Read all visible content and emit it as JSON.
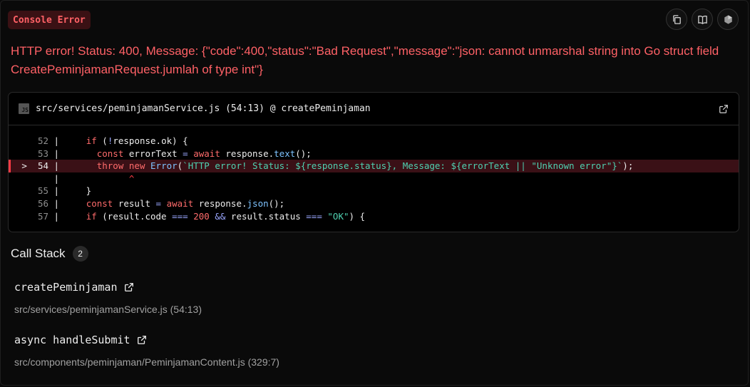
{
  "badge": "Console Error",
  "message": "HTTP error! Status: 400, Message: {\"code\":400,\"status\":\"Bad Request\",\"message\":\"json: cannot unmarshal string into Go struct field CreatePeminjamanRequest.jumlah of type int\"}",
  "code_frame": {
    "file_icon_label": "JS",
    "location": "src/services/peminjamanService.js (54:13) @ createPeminjaman",
    "lines": [
      {
        "num": "52",
        "prefix": " "
      },
      {
        "num": "53",
        "prefix": " "
      },
      {
        "num": "54",
        "prefix": ">"
      },
      {
        "num": "",
        "prefix": " "
      },
      {
        "num": "55",
        "prefix": " "
      },
      {
        "num": "56",
        "prefix": " "
      },
      {
        "num": "57",
        "prefix": " "
      }
    ]
  },
  "call_stack": {
    "title": "Call Stack",
    "count": "2",
    "frames": [
      {
        "fn": "createPeminjaman",
        "loc": "src/services/peminjamanService.js (54:13)"
      },
      {
        "fn": "async handleSubmit",
        "loc": "src/components/peminjaman/PeminjamanContent.js (329:7)"
      }
    ]
  },
  "colors": {
    "error": "#ff6166",
    "highlight_bg": "#3a1016",
    "bg": "#0a0a0a"
  },
  "icons": [
    "copy-icon",
    "docs-icon",
    "nextjs-icon",
    "external-link-icon"
  ]
}
